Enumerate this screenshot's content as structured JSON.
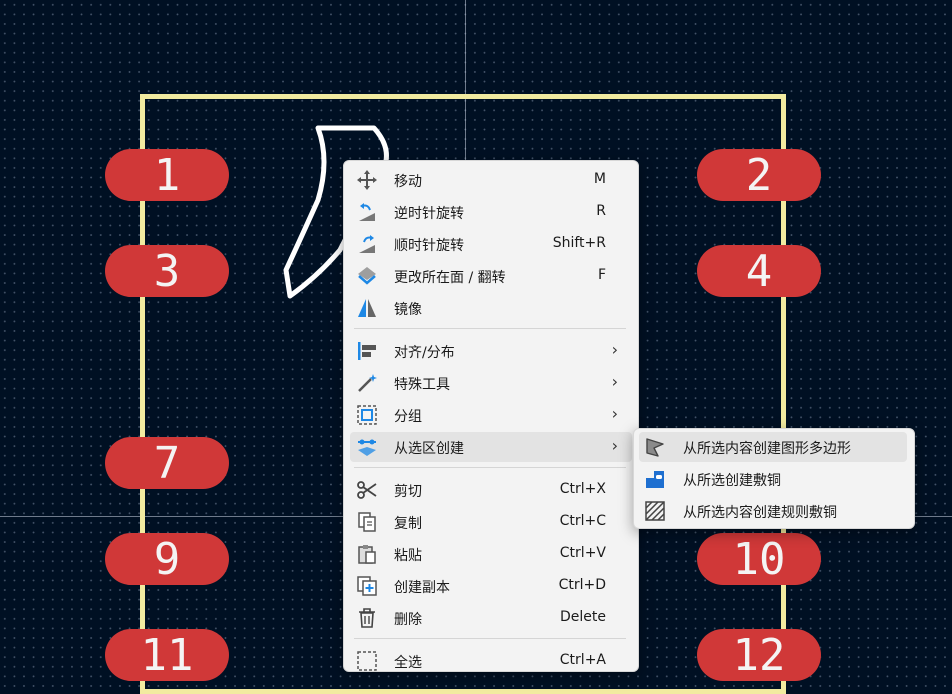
{
  "colors": {
    "background": "#001023",
    "grid_dots": "#96a5be",
    "board_outline": "#f2eba0",
    "pad": "#d03838",
    "pad_text": "#f4f4f4",
    "selection_shape": "#ffffff",
    "menu_bg": "#f3f3f3",
    "menu_highlight": "#e3e3e3"
  },
  "pads": [
    {
      "label": "1"
    },
    {
      "label": "2"
    },
    {
      "label": "3"
    },
    {
      "label": "4"
    },
    {
      "label": "7"
    },
    {
      "label": "9"
    },
    {
      "label": "10"
    },
    {
      "label": "11"
    },
    {
      "label": "12"
    }
  ],
  "context_menu": {
    "items": [
      {
        "label": "移动",
        "shortcut": "M",
        "icon": "move-icon"
      },
      {
        "label": "逆时针旋转",
        "shortcut": "R",
        "icon": "rotate-ccw-icon"
      },
      {
        "label": "顺时针旋转",
        "shortcut": "Shift+R",
        "icon": "rotate-cw-icon"
      },
      {
        "label": "更改所在面 / 翻转",
        "shortcut": "F",
        "icon": "flip-icon"
      },
      {
        "label": "镜像",
        "shortcut": "",
        "icon": "mirror-icon"
      },
      {
        "label": "对齐/分布",
        "submenu_arrow": "›",
        "icon": "align-icon"
      },
      {
        "label": "特殊工具",
        "submenu_arrow": "›",
        "icon": "magic-wand-icon"
      },
      {
        "label": "分组",
        "submenu_arrow": "›",
        "icon": "group-icon"
      },
      {
        "label": "从选区创建",
        "submenu_arrow": "›",
        "icon": "create-from-selection-icon",
        "highlighted": true
      },
      {
        "label": "剪切",
        "shortcut": "Ctrl+X",
        "icon": "scissors-icon"
      },
      {
        "label": "复制",
        "shortcut": "Ctrl+C",
        "icon": "copy-icon"
      },
      {
        "label": "粘贴",
        "shortcut": "Ctrl+V",
        "icon": "paste-icon"
      },
      {
        "label": "创建副本",
        "shortcut": "Ctrl+D",
        "icon": "duplicate-icon"
      },
      {
        "label": "删除",
        "shortcut": "Delete",
        "icon": "trash-icon"
      },
      {
        "label": "全选",
        "shortcut": "Ctrl+A",
        "icon": "select-all-icon"
      }
    ]
  },
  "submenu": {
    "items": [
      {
        "label": "从所选内容创建图形多边形",
        "icon": "polygon-icon",
        "highlighted": true
      },
      {
        "label": "从所选创建敷铜",
        "icon": "copper-zone-icon"
      },
      {
        "label": "从所选内容创建规则敷铜",
        "icon": "rule-area-icon"
      }
    ]
  }
}
